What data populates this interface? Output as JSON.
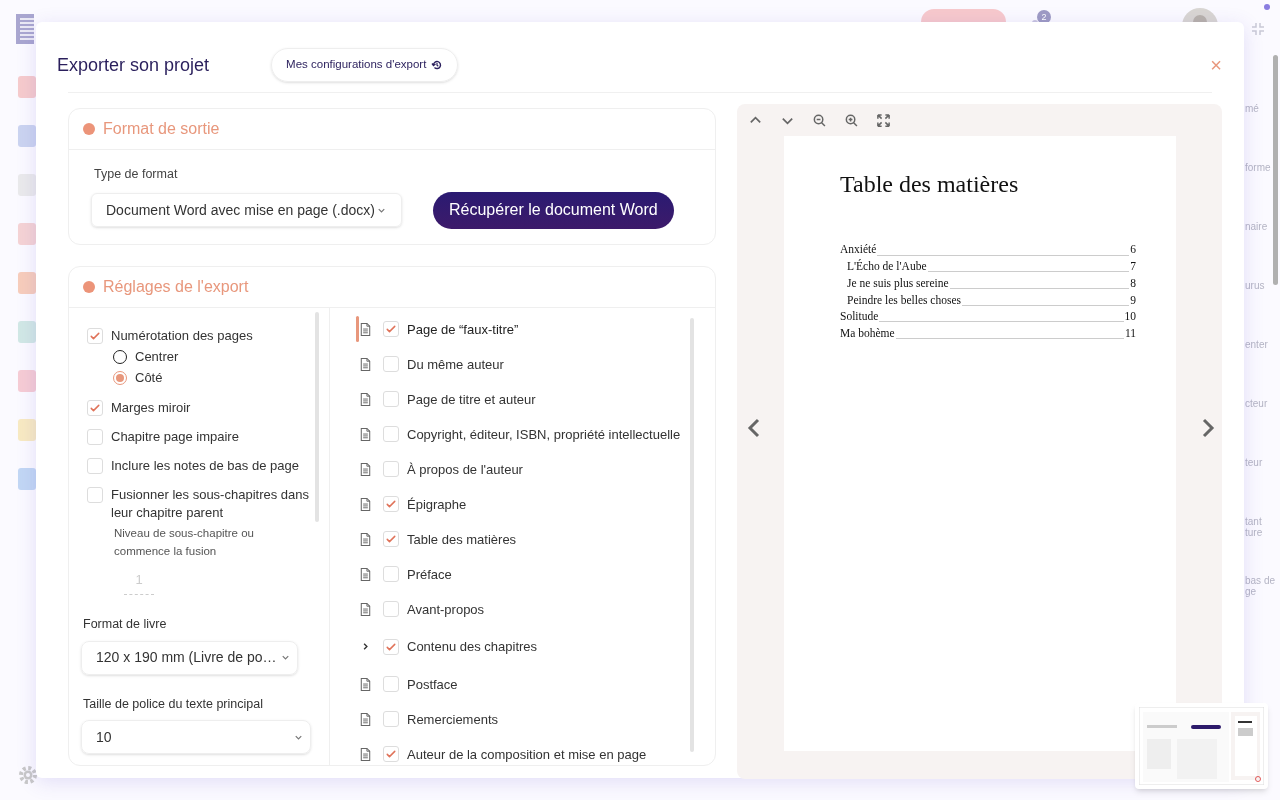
{
  "background": {
    "notification_count": "2",
    "side_labels": [
      {
        "lines": [
          "mé"
        ]
      },
      {
        "lines": [
          "forme"
        ]
      },
      {
        "lines": [
          "naire"
        ]
      },
      {
        "lines": [
          "urus"
        ]
      },
      {
        "lines": [
          "enter"
        ]
      },
      {
        "lines": [
          "cteur"
        ]
      },
      {
        "lines": [
          "teur"
        ]
      },
      {
        "lines": [
          "tant",
          "ture"
        ]
      },
      {
        "lines": [
          "bas de",
          "ge"
        ]
      }
    ]
  },
  "dialog": {
    "title": "Exporter son projet",
    "configs_button": "Mes configurations d'export",
    "close": "×"
  },
  "output_format": {
    "title": "Format de sortie",
    "format_label": "Type de format",
    "format_value": "Document Word avec mise en page (.docx)",
    "download_button": "Récupérer le document Word"
  },
  "settings": {
    "title": "Réglages de l'export",
    "options": [
      {
        "label": "Numérotation des pages",
        "checked": true,
        "choices": [
          {
            "label": "Centrer",
            "selected": false
          },
          {
            "label": "Côté",
            "selected": true
          }
        ]
      },
      {
        "label": "Marges miroir",
        "checked": true
      },
      {
        "label": "Chapitre page impaire",
        "checked": false
      },
      {
        "label": "Inclure les notes de bas de page",
        "checked": false
      },
      {
        "label": "Fusionner les sous-chapitres dans leur chapitre parent",
        "checked": false,
        "sub_label": "Niveau de sous-chapitre ou commence la fusion",
        "sub_value": "1",
        "sub_disabled": true
      }
    ],
    "book_format": {
      "label": "Format de livre",
      "value": "120 x 190 mm (Livre de po…"
    },
    "font_size": {
      "label": "Taille de police du texte principal",
      "value": "10"
    },
    "sections": [
      {
        "kind": "page",
        "label": "Page de “faux-titre”",
        "checked": true,
        "selected": true
      },
      {
        "kind": "page",
        "label": "Du même auteur",
        "checked": false,
        "selected": false
      },
      {
        "kind": "page",
        "label": "Page de titre et auteur",
        "checked": false,
        "selected": false
      },
      {
        "kind": "page",
        "label": "Copyright, éditeur, ISBN, propriété intellectuelle",
        "checked": false,
        "selected": false
      },
      {
        "kind": "page",
        "label": "À propos de l'auteur",
        "checked": false,
        "selected": false
      },
      {
        "kind": "page",
        "label": "Épigraphe",
        "checked": true,
        "selected": false
      },
      {
        "kind": "page",
        "label": "Table des matières",
        "checked": true,
        "selected": false
      },
      {
        "kind": "page",
        "label": "Préface",
        "checked": false,
        "selected": false
      },
      {
        "kind": "page",
        "label": "Avant-propos",
        "checked": false,
        "selected": false
      },
      {
        "kind": "group",
        "label": "Contenu des chapitres",
        "checked": true,
        "selected": false,
        "expanded": false
      },
      {
        "kind": "page",
        "label": "Postface",
        "checked": false,
        "selected": false
      },
      {
        "kind": "page",
        "label": "Remerciements",
        "checked": false,
        "selected": false
      },
      {
        "kind": "page",
        "label": "Auteur de la composition et mise en page",
        "checked": true,
        "selected": false
      }
    ]
  },
  "preview": {
    "title": "Table des matières",
    "toc": [
      {
        "title": "Anxiété",
        "page": "6",
        "children": [
          {
            "title": "L'Écho de l'Aube",
            "page": "7"
          },
          {
            "title": "Je ne suis plus sereine",
            "page": "8"
          },
          {
            "title": "Peindre les belles choses",
            "page": "9"
          }
        ]
      },
      {
        "title": "Solitude",
        "page": "10"
      },
      {
        "title": "Ma bohème",
        "page": "11"
      }
    ]
  }
}
